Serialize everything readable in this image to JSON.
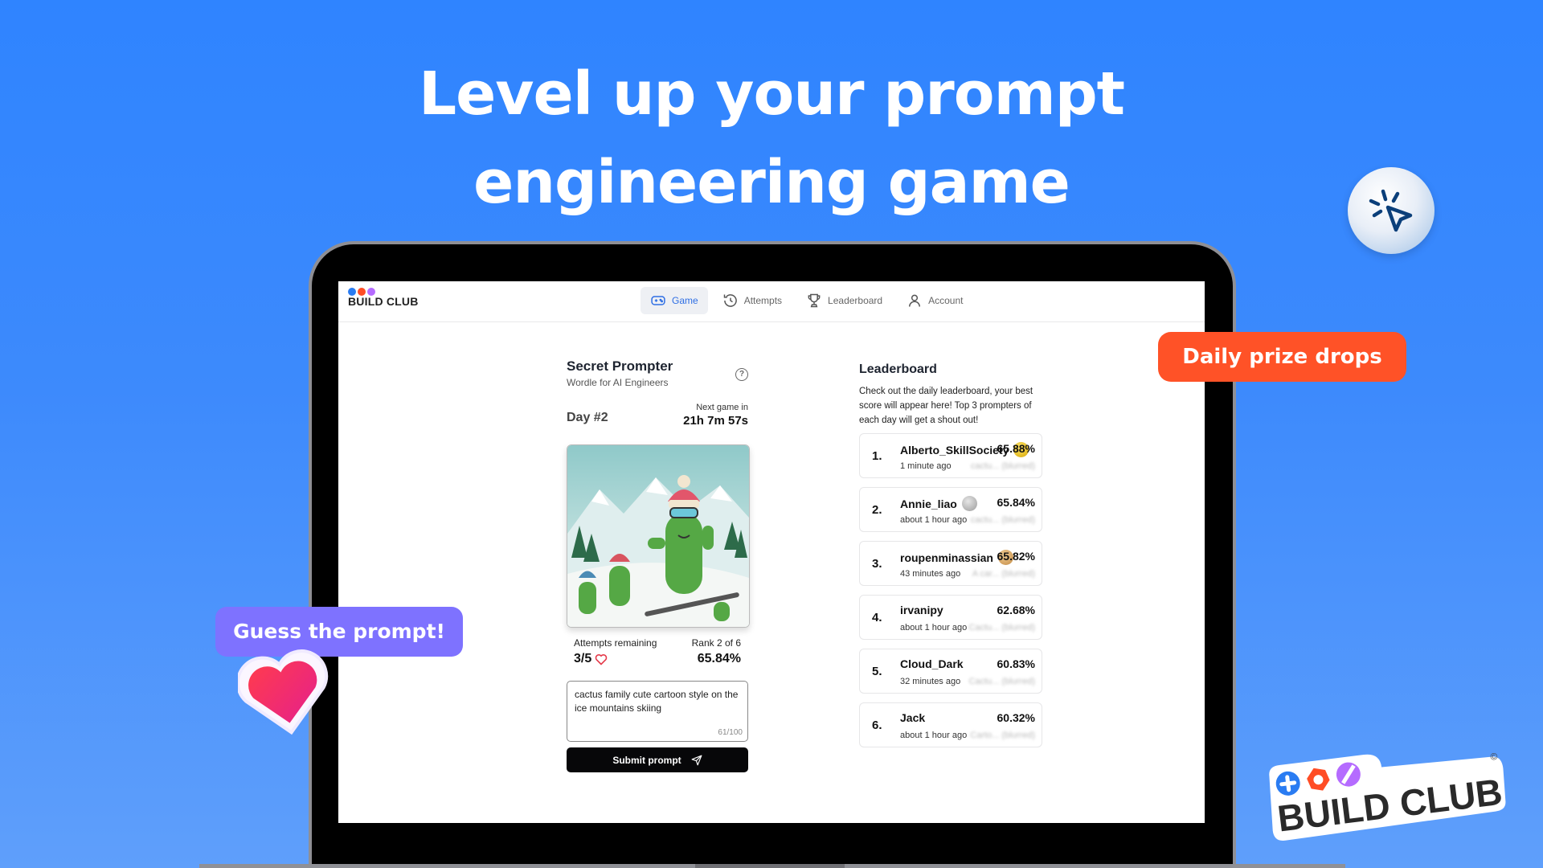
{
  "headline": {
    "line1": "Level up your prompt",
    "line2": "engineering game"
  },
  "badges": {
    "prize": "Daily prize drops",
    "guess": "Guess the prompt!"
  },
  "brand": {
    "name": "BUILD CLUB",
    "mark": "©"
  },
  "nav": {
    "logo_text": "BUILD CLUB",
    "tabs": [
      {
        "label": "Game",
        "icon": "gamepad-icon",
        "active": true
      },
      {
        "label": "Attempts",
        "icon": "history-icon",
        "active": false
      },
      {
        "label": "Leaderboard",
        "icon": "trophy-icon",
        "active": false
      },
      {
        "label": "Account",
        "icon": "user-icon",
        "active": false
      }
    ]
  },
  "game": {
    "title": "Secret Prompter",
    "subtitle": "Wordle for AI Engineers",
    "help": "?",
    "day": "Day #2",
    "next_label": "Next game in",
    "next_value": "21h 7m 57s",
    "image_alt": "Cartoon cactus family skiing on snowy mountains",
    "attempts_label": "Attempts remaining",
    "attempts_value": "3/5",
    "rank_label": "Rank 2 of 6",
    "rank_score": "65.84%",
    "prompt_value": "cactus family cute cartoon style on the ice mountains skiing",
    "char_count": "61/100",
    "submit_label": "Submit prompt"
  },
  "leaderboard": {
    "title": "Leaderboard",
    "description": "Check out the daily leaderboard, your best score will appear here! Top 3 prompters of each day will get a shout out!",
    "rows": [
      {
        "rank": "1.",
        "name": "Alberto_SkillSociety",
        "time": "1 minute ago",
        "score": "65.88%",
        "medal": "gold",
        "guess": "cactu... (blurred)"
      },
      {
        "rank": "2.",
        "name": "Annie_liao",
        "time": "about 1 hour ago",
        "score": "65.84%",
        "medal": "silver",
        "guess": "cactu... (blurred)"
      },
      {
        "rank": "3.",
        "name": "roupenminassian",
        "time": "43 minutes ago",
        "score": "65.82%",
        "medal": "bronze",
        "guess": "A car... (blurred)"
      },
      {
        "rank": "4.",
        "name": "irvanipy",
        "time": "about 1 hour ago",
        "score": "62.68%",
        "medal": "",
        "guess": "Cactu... (blurred)"
      },
      {
        "rank": "5.",
        "name": "Cloud_Dark",
        "time": "32 minutes ago",
        "score": "60.83%",
        "medal": "",
        "guess": "Cactu... (blurred)"
      },
      {
        "rank": "6.",
        "name": "Jack",
        "time": "about 1 hour ago",
        "score": "60.32%",
        "medal": "",
        "guess": "Carto... (blurred)"
      }
    ]
  },
  "colors": {
    "accent": "#2f6fe4",
    "prize": "#ff5227",
    "guess": "#7e72ff",
    "background": "#3d8afc"
  }
}
